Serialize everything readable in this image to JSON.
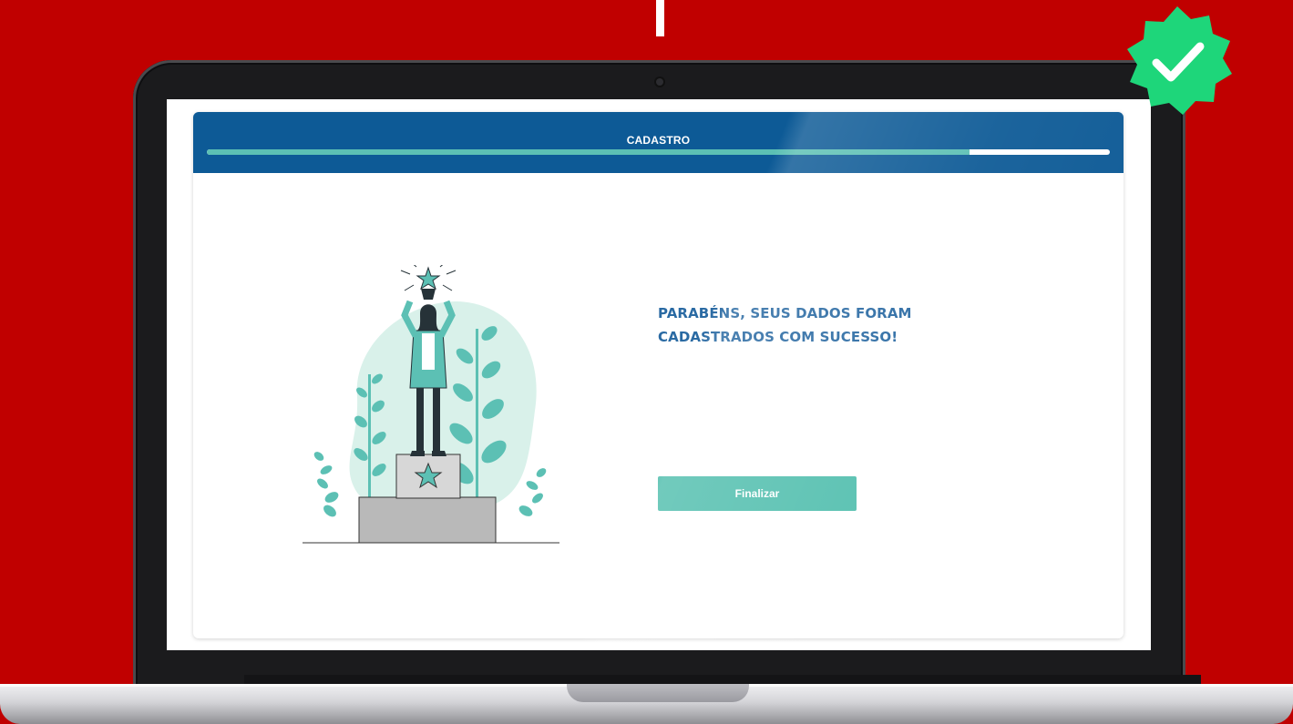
{
  "wizard": {
    "title": "CADASTRO",
    "progress_fraction": 0.845
  },
  "result": {
    "message": "PARABÉNS, SEUS DADOS FORAM CADASTRADOS COM SUCESSO!"
  },
  "actions": {
    "finish_label": "Finalizar"
  },
  "icons": {
    "badge": "verified-check-icon",
    "illustration_star": "star-icon"
  },
  "colors": {
    "background": "#c00000",
    "header": "#0d5a96",
    "progress_fill": "#5cc0b4",
    "button": "#56c0b0",
    "message_text": "#2a6aa3",
    "badge": "#1ed67a"
  }
}
